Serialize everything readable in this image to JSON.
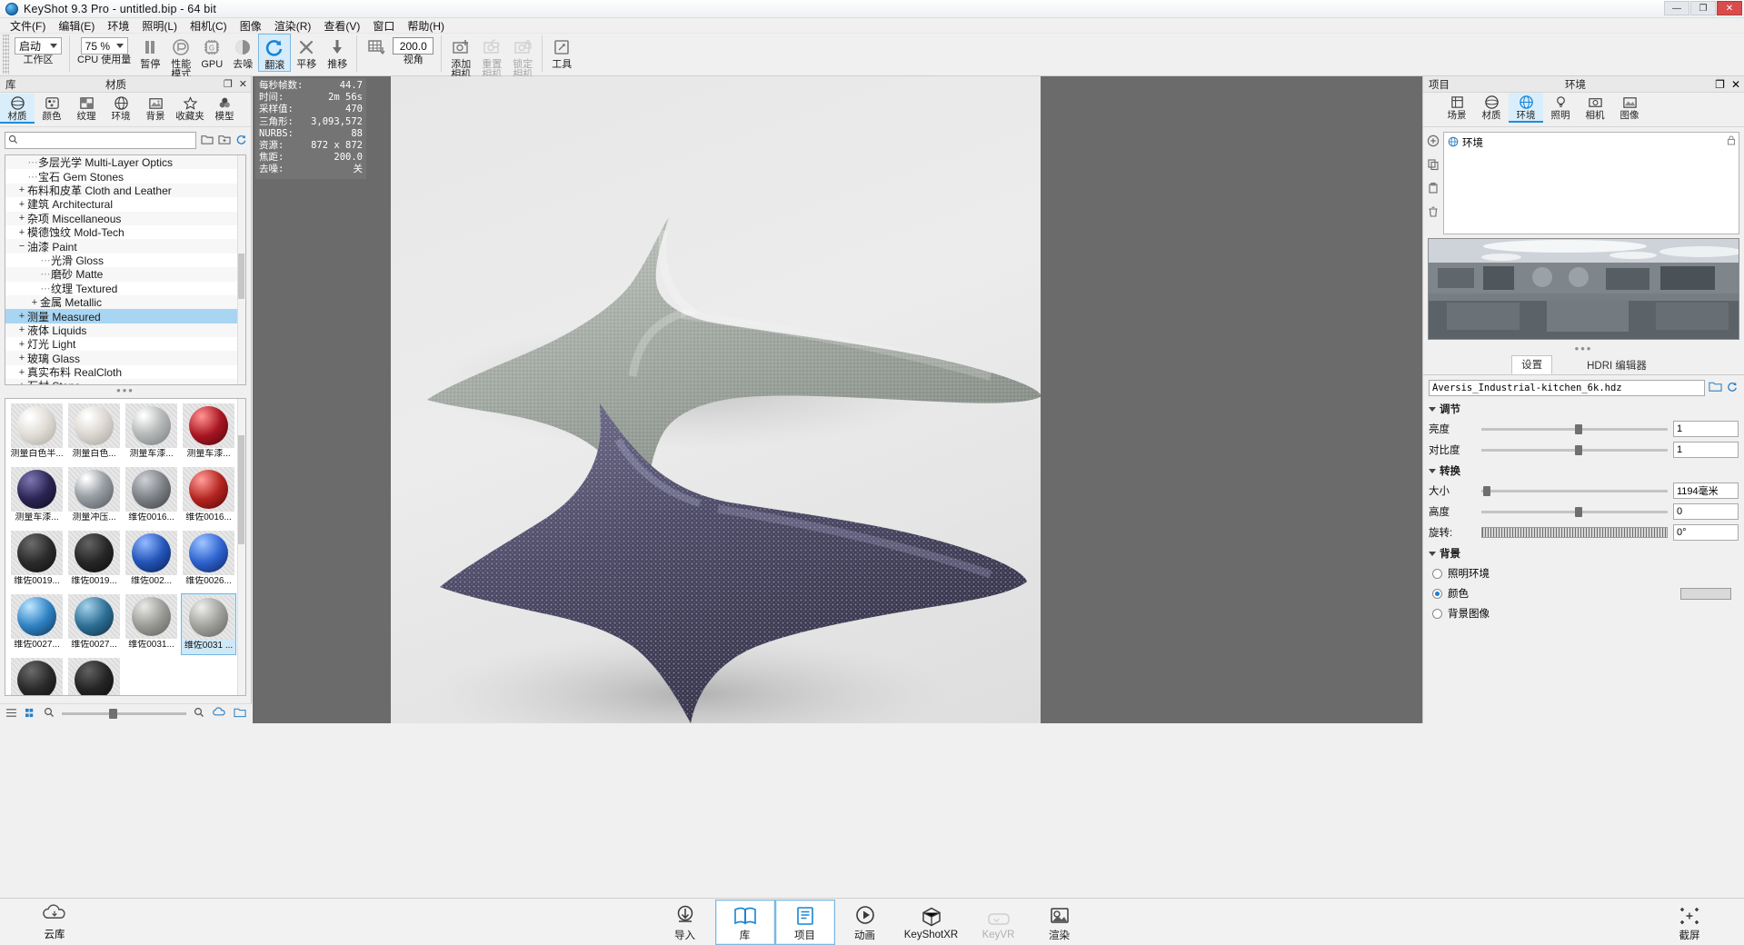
{
  "window": {
    "title": "KeyShot 9.3 Pro  - untitled.bip  - 64 bit",
    "minimize": "—",
    "maximize": "❐",
    "close": "✕"
  },
  "menu": [
    {
      "label": "文件(F)"
    },
    {
      "label": "编辑(E)"
    },
    {
      "label": "环境"
    },
    {
      "label": "照明(L)"
    },
    {
      "label": "相机(C)"
    },
    {
      "label": "图像"
    },
    {
      "label": "渲染(R)"
    },
    {
      "label": "查看(V)"
    },
    {
      "label": "窗口"
    },
    {
      "label": "帮助(H)"
    }
  ],
  "toolbar": {
    "workspace_value": "启动",
    "workspace_label": "工作区",
    "cpu_value": "75 %",
    "cpu_label": "CPU 使用量",
    "pause_label": "暂停",
    "performance_label": "性能\n模式",
    "performance_label_1": "性能",
    "performance_label_2": "模式",
    "gpu_label": "GPU",
    "denoise_label": "去噪",
    "rollover_label": "翻滚",
    "pan_label": "平移",
    "dolly_label": "推移",
    "fov_value": "200.0",
    "view_label": "视角",
    "add_camera_label_1": "添加",
    "add_camera_label_2": "相机",
    "reset_camera_label_1": "重置",
    "reset_camera_label_2": "相机",
    "lock_camera_label_1": "锁定",
    "lock_camera_label_2": "相机",
    "tools_label": "工具"
  },
  "library_panel": {
    "tab_library": "库",
    "tab_material": "材质",
    "float_icon": "❐",
    "close_icon": "✕",
    "tabs": [
      {
        "label": "材质",
        "icon": "sphere-icon",
        "selected": true
      },
      {
        "label": "颜色",
        "icon": "palette-icon",
        "selected": false
      },
      {
        "label": "纹理",
        "icon": "checker-icon",
        "selected": false
      },
      {
        "label": "环境",
        "icon": "globe-icon",
        "selected": false
      },
      {
        "label": "背景",
        "icon": "image-icon",
        "selected": false
      },
      {
        "label": "收藏夹",
        "icon": "star-icon",
        "selected": false
      },
      {
        "label": "模型",
        "icon": "cubes-icon",
        "selected": false
      }
    ],
    "search_placeholder": "",
    "search_value": "",
    "tree": [
      {
        "label": "多层光学 Multi-Layer Optics",
        "indent": 1,
        "toggle": "leaf",
        "selected": false
      },
      {
        "label": "宝石 Gem Stones",
        "indent": 1,
        "toggle": "leaf",
        "selected": false
      },
      {
        "label": "布料和皮革 Cloth and Leather",
        "indent": 0,
        "toggle": "+",
        "selected": false
      },
      {
        "label": "建筑 Architectural",
        "indent": 0,
        "toggle": "+",
        "selected": false
      },
      {
        "label": "杂项 Miscellaneous",
        "indent": 0,
        "toggle": "+",
        "selected": false
      },
      {
        "label": "模德蚀纹 Mold-Tech",
        "indent": 0,
        "toggle": "+",
        "selected": false
      },
      {
        "label": "油漆 Paint",
        "indent": 0,
        "toggle": "−",
        "selected": false
      },
      {
        "label": "光滑 Gloss",
        "indent": 1,
        "toggle": "leaf",
        "selected": false
      },
      {
        "label": "磨砂 Matte",
        "indent": 1,
        "toggle": "leaf",
        "selected": false
      },
      {
        "label": "纹理 Textured",
        "indent": 1,
        "toggle": "leaf",
        "selected": false
      },
      {
        "label": "金属 Metallic",
        "indent": 1,
        "toggle": "+",
        "selected": false
      },
      {
        "label": "测量 Measured",
        "indent": 0,
        "toggle": "+",
        "selected": true
      },
      {
        "label": "液体 Liquids",
        "indent": 0,
        "toggle": "+",
        "selected": false
      },
      {
        "label": "灯光 Light",
        "indent": 0,
        "toggle": "+",
        "selected": false
      },
      {
        "label": "玻璃 Glass",
        "indent": 0,
        "toggle": "+",
        "selected": false
      },
      {
        "label": "真实布料 RealCloth",
        "indent": 0,
        "toggle": "+",
        "selected": false
      },
      {
        "label": "石材 Stone",
        "indent": 0,
        "toggle": "+",
        "selected": false
      }
    ],
    "materials": [
      {
        "label": "测量白色半...",
        "color": "#e3dfd8",
        "selected": false
      },
      {
        "label": "测量白色...",
        "color": "#dedad3",
        "selected": false
      },
      {
        "label": "测量车漆...",
        "color": "#b9bcbc",
        "selected": false
      },
      {
        "label": "测量车漆...",
        "color": "#a81622",
        "selected": false
      },
      {
        "label": "测量车漆...",
        "color": "#2b2553",
        "selected": false
      },
      {
        "label": "测量冲压...",
        "color": "#9aa0a6",
        "selected": false
      },
      {
        "label": "维佐0016...",
        "color": "#7b7f84",
        "selected": false
      },
      {
        "label": "维佐0016...",
        "color": "#b4241f",
        "selected": false
      },
      {
        "label": "维佐0019...",
        "color": "#2b2b2b",
        "selected": false
      },
      {
        "label": "维佐0019...",
        "color": "#262626",
        "selected": false
      },
      {
        "label": "维佐002...",
        "color": "#2355b8",
        "selected": false
      },
      {
        "label": "维佐0026...",
        "color": "#2f63cf",
        "selected": false
      },
      {
        "label": "维佐0027...",
        "color": "#2f82c4",
        "selected": false
      },
      {
        "label": "维佐0027...",
        "color": "#2d6f95",
        "selected": false
      },
      {
        "label": "维佐0031...",
        "color": "#9a9a96",
        "selected": false
      },
      {
        "label": "维佐0031 ...",
        "color": "#9f9f9b",
        "selected": true
      },
      {
        "label": "",
        "color": "#2a2a2a",
        "selected": false
      },
      {
        "label": "",
        "color": "#242424",
        "selected": false
      }
    ],
    "footer": {
      "list_icon": "list-view-icon",
      "grid_icon": "grid-view-icon",
      "zoom_icon": "magnifier-icon",
      "search_icon": "search-icon",
      "cloud_icon": "cloud-download-icon",
      "folder_icon": "folder-icon"
    }
  },
  "viewport": {
    "stats": [
      {
        "key": "每秒帧数:",
        "value": "44.7"
      },
      {
        "key": "时间:",
        "value": "2m 56s"
      },
      {
        "key": "采样值:",
        "value": "470"
      },
      {
        "key": "三角形:",
        "value": "3,093,572"
      },
      {
        "key": "NURBS:",
        "value": "88"
      },
      {
        "key": "资源:",
        "value": "872 x 872"
      },
      {
        "key": "焦距:",
        "value": "200.0"
      },
      {
        "key": "去噪:",
        "value": "关"
      }
    ]
  },
  "environment_panel": {
    "tab_project": "项目",
    "tab_environment": "环境",
    "float_icon": "❐",
    "close_icon": "✕",
    "tabs": [
      {
        "label": "场景",
        "icon": "scene-icon",
        "selected": false
      },
      {
        "label": "材质",
        "icon": "material-icon",
        "selected": false
      },
      {
        "label": "环境",
        "icon": "globe-icon",
        "selected": true
      },
      {
        "label": "照明",
        "icon": "light-icon",
        "selected": false
      },
      {
        "label": "相机",
        "icon": "camera-icon",
        "selected": false
      },
      {
        "label": "图像",
        "icon": "image-icon",
        "selected": false
      }
    ],
    "side_tools": [
      "add-icon",
      "copy-icon",
      "paste-icon",
      "delete-icon"
    ],
    "list_item": "环境",
    "lock_icon": "lock-icon",
    "sub_tabs": [
      {
        "label": "设置",
        "active": true
      },
      {
        "label": "HDRI 编辑器",
        "active": false
      }
    ],
    "hdri_path": "Aversis_Industrial-kitchen_6k.hdz",
    "browse_icon": "folder-icon",
    "refresh_icon": "refresh-icon",
    "adjust": {
      "title": "调节",
      "brightness_label": "亮度",
      "brightness_value": "1",
      "contrast_label": "对比度",
      "contrast_value": "1"
    },
    "transform": {
      "title": "转换",
      "size_label": "大小",
      "size_value": "1194毫米",
      "height_label": "高度",
      "height_value": "0",
      "rotation_label": "旋转:",
      "rotation_value": "0°"
    },
    "background": {
      "title": "背景",
      "options": [
        {
          "label": "照明环境",
          "selected": false
        },
        {
          "label": "颜色",
          "selected": true
        },
        {
          "label": "背景图像",
          "selected": false
        }
      ],
      "color_swatch": "#d9d9d9"
    }
  },
  "bottombar": {
    "cloud_label": "云库",
    "items": [
      {
        "label": "导入",
        "icon": "import-icon",
        "active": false,
        "dim": false
      },
      {
        "label": "库",
        "icon": "book-icon",
        "active": true,
        "dim": false
      },
      {
        "label": "项目",
        "icon": "project-icon",
        "active": true,
        "dim": false
      },
      {
        "label": "动画",
        "icon": "play-icon",
        "active": false,
        "dim": false
      },
      {
        "label": "KeyShotXR",
        "icon": "xr-icon",
        "active": false,
        "dim": false
      },
      {
        "label": "KeyVR",
        "icon": "vr-icon",
        "active": false,
        "dim": true
      },
      {
        "label": "渲染",
        "icon": "render-icon",
        "active": false,
        "dim": false
      }
    ],
    "screenshot_label": "截屏",
    "screenshot_icon": "crop-icon"
  }
}
